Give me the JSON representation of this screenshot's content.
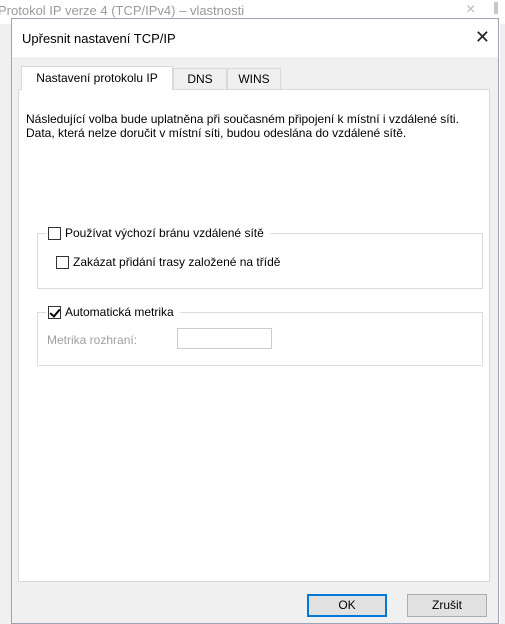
{
  "background_window": {
    "title": "Protokol IP verze 4 (TCP/IPv4) – vlastnosti",
    "close_glyph": "×"
  },
  "dialog": {
    "title": "Upřesnit nastavení TCP/IP",
    "close_glyph": "✕"
  },
  "tabs": [
    {
      "label": "Nastavení protokolu IP",
      "active": true
    },
    {
      "label": "DNS",
      "active": false
    },
    {
      "label": "WINS",
      "active": false
    }
  ],
  "description": "Následující volba bude uplatněna při současném připojení k místní i vzdálené síti. Data, která nelze doručit v místní síti, budou odeslána do vzdálené sítě.",
  "gateway_group": {
    "label": "Používat výchozí bránu vzdálené sítě",
    "checked": false,
    "sub_option": {
      "label": "Zakázat přidání trasy založené na třídě",
      "checked": false
    }
  },
  "metric_group": {
    "label": "Automatická metrika",
    "checked": true,
    "interface_metric_label": "Metrika rozhraní:",
    "interface_metric_value": ""
  },
  "buttons": {
    "ok": "OK",
    "cancel": "Zrušit"
  }
}
